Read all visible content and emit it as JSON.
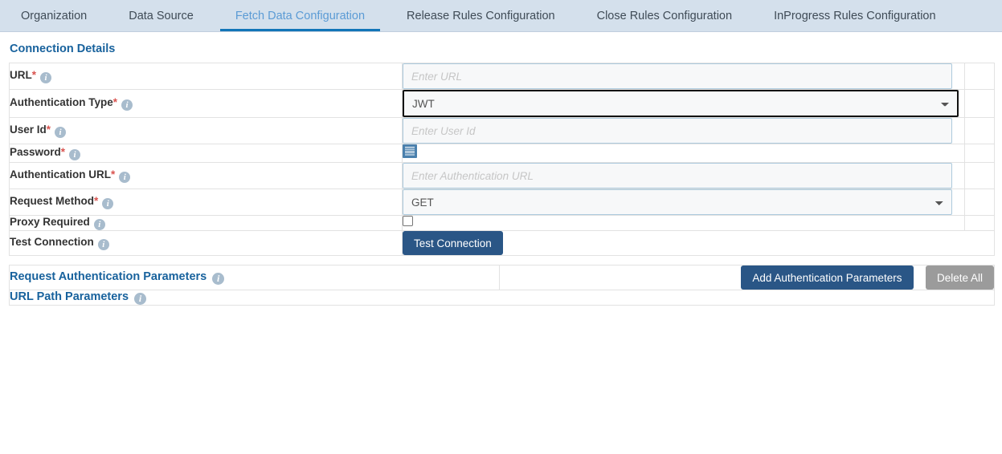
{
  "tabs": [
    {
      "label": "Organization",
      "active": false
    },
    {
      "label": "Data Source",
      "active": false
    },
    {
      "label": "Fetch Data Configuration",
      "active": true
    },
    {
      "label": "Release Rules Configuration",
      "active": false
    },
    {
      "label": "Close Rules Configuration",
      "active": false
    },
    {
      "label": "InProgress Rules Configuration",
      "active": false
    }
  ],
  "colors": {
    "tabbar_bg": "#d4e0ec",
    "active_tab_text": "#5b9bd5",
    "active_tab_underline": "#1275b8",
    "section_heading": "#18629d",
    "required_asterisk": "#d9534f",
    "primary_button": "#2a5686",
    "grey_button": "#9b9b9b",
    "info_icon": "#a8bccd",
    "input_border": "#accadd",
    "input_bg": "#f7f8f9",
    "focus_border": "#111111"
  },
  "section": {
    "connection_details": {
      "title": "Connection Details",
      "rows": [
        {
          "label": "URL",
          "required": true,
          "info_icon": "info-circle-icon",
          "control": "text",
          "name": "url",
          "value": "",
          "placeholder": "Enter URL"
        },
        {
          "label": "Authentication Type",
          "required": true,
          "info_icon": "info-circle-icon",
          "control": "select",
          "name": "authentication-type",
          "value": "JWT",
          "focused": true,
          "options": [
            "JWT"
          ]
        },
        {
          "label": "User Id",
          "required": true,
          "info_icon": "info-circle-icon",
          "control": "text",
          "name": "user-id",
          "value": "",
          "placeholder": "Enter User Id"
        },
        {
          "label": "Password",
          "required": true,
          "info_icon": "info-circle-icon",
          "control": "icon",
          "name": "password",
          "icon": "document-lines-icon"
        },
        {
          "label": "Authentication URL",
          "required": true,
          "info_icon": "info-circle-icon",
          "control": "text",
          "name": "authentication-url",
          "value": "",
          "placeholder": "Enter Authentication URL"
        },
        {
          "label": "Request Method",
          "required": true,
          "info_icon": "info-circle-icon",
          "control": "select",
          "name": "request-method",
          "value": "GET",
          "focused": false,
          "options": [
            "GET"
          ]
        },
        {
          "label": "Proxy Required",
          "required": false,
          "info_icon": "info-circle-icon",
          "control": "checkbox",
          "name": "proxy-required",
          "checked": false
        },
        {
          "label": "Test Connection",
          "required": false,
          "info_icon": "info-circle-icon",
          "control": "button",
          "name": "test-connection",
          "button_label": "Test Connection"
        }
      ]
    },
    "request_authentication_parameters": {
      "title": "Request Authentication Parameters",
      "info_icon": "info-circle-icon",
      "add_button": "Add Authentication Parameters",
      "delete_button": "Delete All"
    },
    "url_path_parameters": {
      "title": "URL Path Parameters",
      "info_icon": "info-circle-icon"
    }
  }
}
